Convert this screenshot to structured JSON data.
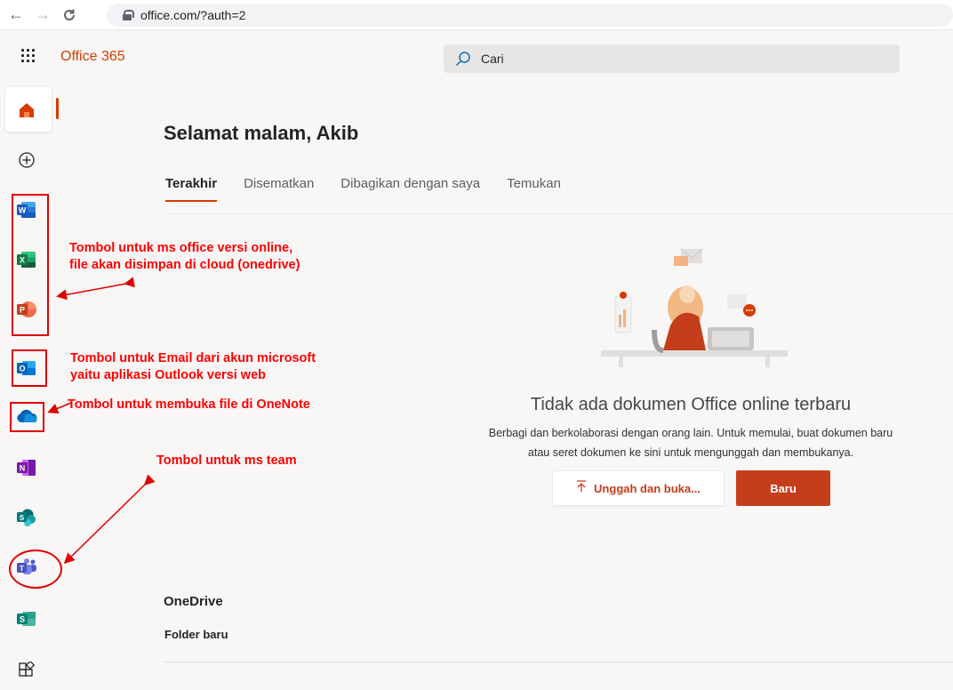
{
  "browser": {
    "url": "office.com/?auth=2",
    "back_icon": "←",
    "forward_icon": "→",
    "reload_icon": "C"
  },
  "header": {
    "brand": "Office 365",
    "search_placeholder": "Cari"
  },
  "rail": {
    "items": [
      {
        "name": "home",
        "label": ""
      },
      {
        "name": "create",
        "label": ""
      },
      {
        "name": "word",
        "letter": "W",
        "color": "#185abd"
      },
      {
        "name": "excel",
        "letter": "X",
        "color": "#107c41"
      },
      {
        "name": "powerpoint",
        "letter": "P",
        "color": "#c43e1c"
      },
      {
        "name": "outlook",
        "letter": "O",
        "color": "#0078d4"
      },
      {
        "name": "onedrive",
        "letter": "",
        "color": "#0364b8"
      },
      {
        "name": "onenote",
        "letter": "N",
        "color": "#7719aa"
      },
      {
        "name": "sharepoint",
        "letter": "S",
        "color": "#036c70"
      },
      {
        "name": "teams",
        "letter": "T",
        "color": "#4b53bc"
      },
      {
        "name": "sway",
        "letter": "S",
        "color": "#008272"
      },
      {
        "name": "all-apps",
        "letter": ""
      }
    ]
  },
  "main": {
    "greeting": "Selamat malam, Akib",
    "tabs": [
      "Terakhir",
      "Disematkan",
      "Dibagikan dengan saya",
      "Temukan"
    ],
    "empty_title": "Tidak ada dokumen Office online terbaru",
    "empty_desc_line1": "Berbagi dan berkolaborasi dengan orang lain. Untuk memulai, buat dokumen baru",
    "empty_desc_line2": "atau seret dokumen ke sini untuk mengunggah dan membukanya.",
    "upload_label": "Unggah dan buka...",
    "new_label": "Baru",
    "onedrive_title": "OneDrive",
    "folder_new": "Folder baru"
  },
  "annotations": {
    "office_online_line1": "Tombol untuk ms office versi online,",
    "office_online_line2": "file akan disimpan di cloud (onedrive)",
    "email_line1": "Tombol untuk Email dari akun microsoft",
    "email_line2": "yaitu aplikasi Outlook versi web",
    "onenote": "Tombol untuk membuka file di OneNote",
    "teams": "Tombol untuk ms team"
  },
  "colors": {
    "accent": "#d83b01",
    "button_primary": "#c43e1c",
    "annotation": "#ff0000"
  }
}
